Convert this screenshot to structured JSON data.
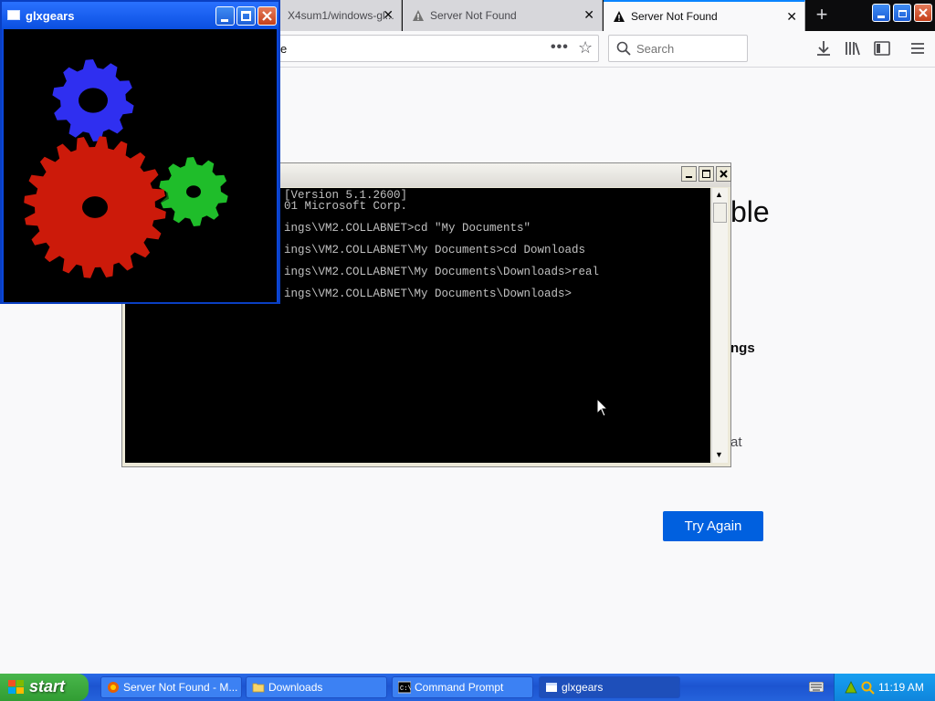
{
  "firefox": {
    "tabs": [
      {
        "label": "X4sum1/windows-gl..."
      },
      {
        "label": "Server Not Found"
      },
      {
        "label": "Server Not Found"
      }
    ],
    "url_fragment": "e",
    "search_placeholder": "Search",
    "error_title_fragment": "ble",
    "error_bold_fragment": "ngs",
    "error_text_fragment": "at",
    "try_again_label": "Try Again"
  },
  "cmd": {
    "lines": [
      "[Version 5.1.2600]",
      "01 Microsoft Corp.",
      "ings\\VM2.COLLABNET>cd \"My Documents\"",
      "ings\\VM2.COLLABNET\\My Documents>cd Downloads",
      "ings\\VM2.COLLABNET\\My Documents\\Downloads>real",
      "ings\\VM2.COLLABNET\\My Documents\\Downloads>"
    ]
  },
  "glx": {
    "title": "glxgears",
    "colors": {
      "red": "#cc1a0a",
      "green": "#1fbd2a",
      "blue": "#2f2ff0"
    }
  },
  "taskbar": {
    "start_label": "start",
    "tasks": [
      {
        "label": "Server Not Found - M..."
      },
      {
        "label": "Downloads"
      },
      {
        "label": "Command Prompt"
      },
      {
        "label": "glxgears"
      }
    ],
    "clock": "11:19 AM"
  }
}
